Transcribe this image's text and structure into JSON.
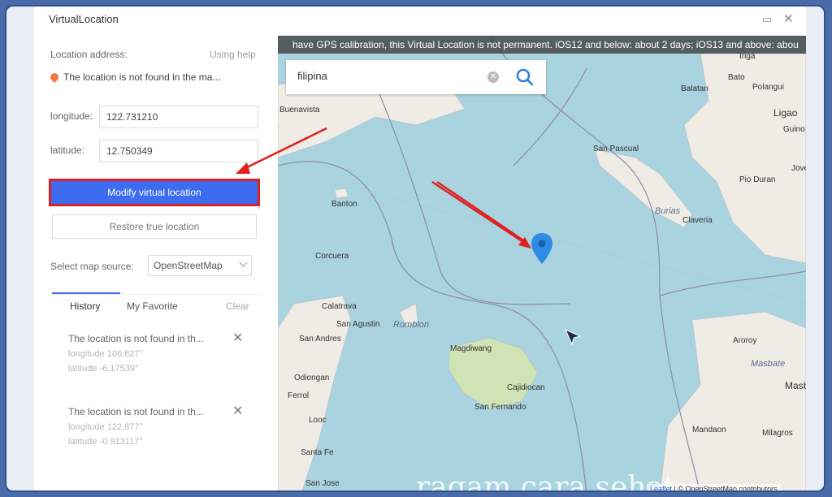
{
  "window": {
    "title": "VirtualLocation"
  },
  "sidebar": {
    "location_address_label": "Location address:",
    "using_help": "Using help",
    "location_value": "The location is not found in the ma...",
    "longitude_label": "longitude:",
    "longitude_value": "122.731210",
    "latitude_label": "latitude:",
    "latitude_value": "12.750349",
    "modify_button": "Modify virtual location",
    "restore_button": "Restore true location",
    "map_source_label": "Select map source:",
    "map_source_value": "OpenStreetMap",
    "tabs": {
      "history": "History",
      "favorite": "My Favorite",
      "clear": "Clear"
    },
    "history": [
      {
        "title": "The location is not found in th...",
        "longitude": "longitude 106.827°",
        "latitude": "latitude -6.17539°"
      },
      {
        "title": "The location is not found in th...",
        "longitude": "longitude 122.877°",
        "latitude": "latitude -0.913117°"
      }
    ]
  },
  "map": {
    "banner": "have GPS calibration, this Virtual Location is not permanent. iOS12 and below: about 2 days; iOS13 and above: abou",
    "search_value": "filipina",
    "places": [
      "Buenavista",
      "Iriga",
      "Bato",
      "Polangui",
      "Balatan",
      "Ligao",
      "Guino",
      "San Pascual",
      "Jove",
      "Pio Duran",
      "Banton",
      "Burias",
      "Claveria",
      "Corcuera",
      "Calatrava",
      "San Agustin",
      "Romblon",
      "San Andres",
      "Magdiwang",
      "Odiongan",
      "Cajidiocan",
      "Ferrol",
      "San Fernando",
      "Looc",
      "Santa Fe",
      "San Jose",
      "Aroroy",
      "Masbate",
      "Masb",
      "Mandaon",
      "Milagros"
    ],
    "watermark": "ragam cara sehat",
    "attribution_leaflet": "Leaflet",
    "attribution_text": "| © OpenStreetMap contributors"
  },
  "colors": {
    "accent": "#3d6cf0",
    "highlight_border": "#e02020",
    "sea": "#a9d3df",
    "land": "#efece6",
    "pin": "#2f8be6"
  }
}
